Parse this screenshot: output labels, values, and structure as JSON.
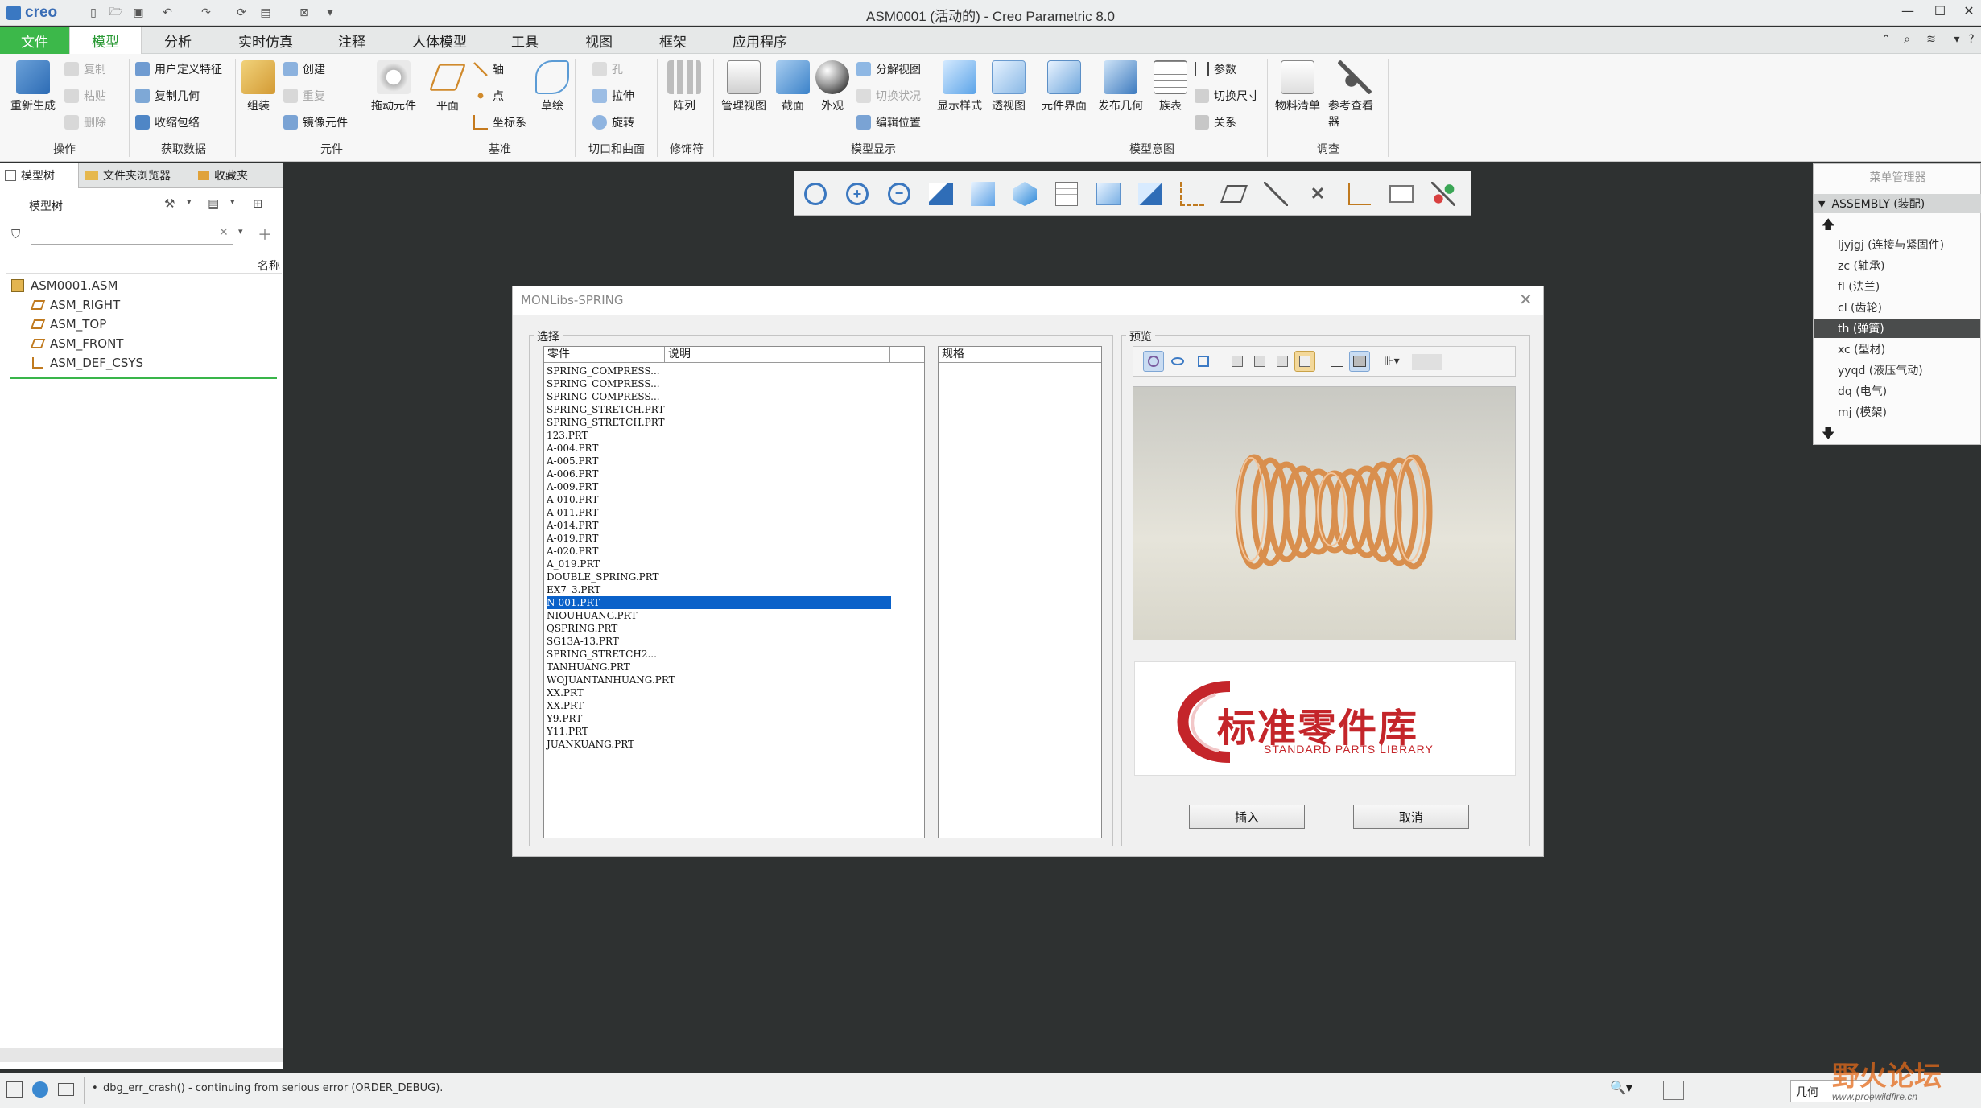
{
  "app": {
    "logo": "creo",
    "window_title": "ASM0001 (活动的) - Creo Parametric 8.0"
  },
  "menu_tabs": [
    "文件",
    "模型",
    "分析",
    "实时仿真",
    "注释",
    "人体模型",
    "工具",
    "视图",
    "框架",
    "应用程序"
  ],
  "ribbon": {
    "operations": {
      "regenerate": "重新生成",
      "copy": "复制",
      "paste": "粘贴",
      "delete": "删除",
      "label": "操作"
    },
    "get_data": {
      "udf": "用户定义特征",
      "copy_geom": "复制几何",
      "shrinkwrap": "收缩包络",
      "label": "获取数据"
    },
    "component": {
      "assemble": "组装",
      "create": "创建",
      "repeat": "重复",
      "mirror": "镜像元件",
      "drag": "拖动元件",
      "label": "元件"
    },
    "datum": {
      "plane": "平面",
      "axis": "轴",
      "point": "点",
      "csys": "坐标系",
      "sketch": "草绘",
      "label": "基准"
    },
    "cuts": {
      "hole": "孔",
      "extrude": "拉伸",
      "revolve": "旋转",
      "label": "切口和曲面"
    },
    "modifiers": {
      "pattern": "阵列",
      "label": "修饰符"
    },
    "model_display": {
      "manage_views": "管理视图",
      "section": "截面",
      "appearance": "外观",
      "exploded": "分解视图",
      "toggle_status": "切换状况",
      "edit_position": "编辑位置",
      "display_style": "显示样式",
      "perspective": "透视图",
      "label": "模型显示"
    },
    "model_intent": {
      "comp_interface": "元件界面",
      "publish_geom": "发布几何",
      "family_table": "族表",
      "params": "参数",
      "switch_dims": "切换尺寸",
      "relations": "关系",
      "label": "模型意图"
    },
    "investigate": {
      "bom": "物料清单",
      "ref_viewer": "参考查看器",
      "label": "调查"
    }
  },
  "left_panel": {
    "tabs": [
      "模型树",
      "文件夹浏览器",
      "收藏夹"
    ],
    "header": "模型树",
    "column": "名称",
    "tree": [
      "ASM0001.ASM",
      "ASM_RIGHT",
      "ASM_TOP",
      "ASM_FRONT",
      "ASM_DEF_CSYS"
    ]
  },
  "dialog": {
    "title": "MONLibs-SPRING",
    "select_label": "选择",
    "preview_label": "预览",
    "col_part": "零件",
    "col_desc": "说明",
    "col_spec": "规格",
    "parts": [
      "SPRING_COMPRESS...",
      "SPRING_COMPRESS...",
      "SPRING_COMPRESS...",
      "SPRING_STRETCH.PRT",
      "SPRING_STRETCH.PRT",
      "123.PRT",
      "A-004.PRT",
      "A-005.PRT",
      "A-006.PRT",
      "A-009.PRT",
      "A-010.PRT",
      "A-011.PRT",
      "A-014.PRT",
      "A-019.PRT",
      "A-020.PRT",
      "A_019.PRT",
      "DOUBLE_SPRING.PRT",
      "EX7_3.PRT",
      "N-001.PRT",
      "NIOUHUANG.PRT",
      "QSPRING.PRT",
      "SG13A-13.PRT",
      "SPRING_STRETCH2...",
      "TANHUANG.PRT",
      "WOJUANTANHUANG.PRT",
      "XX.PRT",
      "XX.PRT",
      "Y9.PRT",
      "Y11.PRT",
      "JUANKUANG.PRT"
    ],
    "selected_part": "N-001.PRT",
    "logo_cn": "标准零件库",
    "logo_en": "STANDARD PARTS LIBRARY",
    "insert_button": "插入",
    "cancel_button": "取消"
  },
  "menu_manager": {
    "title": "菜单管理器",
    "header": "ASSEMBLY (装配)",
    "items": [
      "ljyjgj (连接与紧固件)",
      "zc (轴承)",
      "fl (法兰)",
      "cl (齿轮)",
      "th (弹簧)",
      "xc (型材)",
      "yyqd (液压气动)",
      "dq (电气)",
      "mj (模架)"
    ],
    "selected": "th (弹簧)"
  },
  "status": {
    "message": "dbg_err_crash() - continuing from serious error (ORDER_DEBUG).",
    "filter": "几何",
    "watermark": "野火论坛",
    "watermark_url": "www.proewildfire.cn"
  },
  "colors": {
    "file_tab": "#3cb84a",
    "active_green": "#2b9a36",
    "viewport": "#2e3131",
    "selection": "#0a61c9",
    "logo_red": "#c4252a"
  }
}
